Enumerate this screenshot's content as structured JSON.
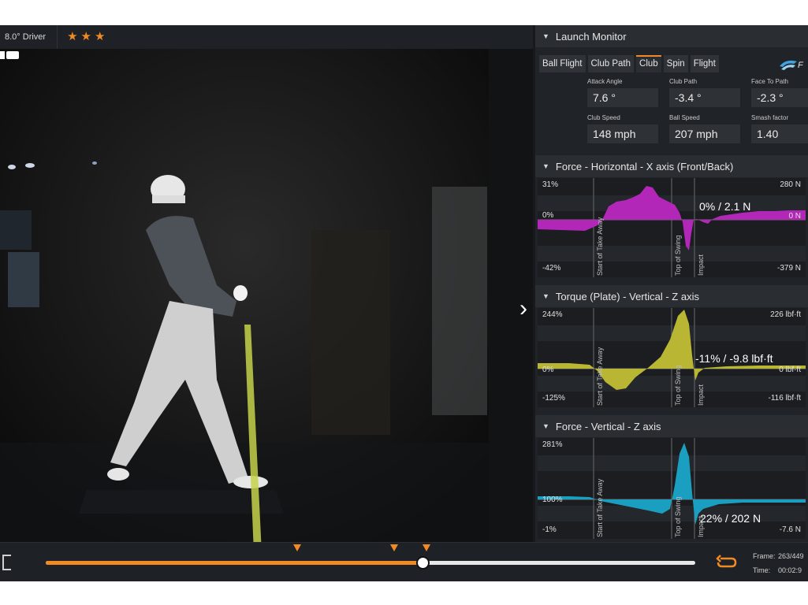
{
  "video": {
    "club_label": "8.0° Driver",
    "rating": 3
  },
  "launch_monitor": {
    "title": "Launch Monitor",
    "tabs": [
      "Ball Flight",
      "Club Path",
      "Club",
      "Spin",
      "Flight"
    ],
    "active_tab": "Club",
    "metrics": [
      {
        "label": "Attack Angle",
        "value": "7.6 °"
      },
      {
        "label": "Club Path",
        "value": "-3.4 °"
      },
      {
        "label": "Face To Path",
        "value": "-2.3 °"
      },
      {
        "label": "Club Speed",
        "value": "148 mph"
      },
      {
        "label": "Ball Speed",
        "value": "207 mph"
      },
      {
        "label": "Smash factor",
        "value": "1.40"
      }
    ]
  },
  "graphs": [
    {
      "title": "Force - Horizontal - X axis (Front/Back)",
      "color": "#b227b8",
      "top_left": "31%",
      "top_right": "280 N",
      "mid_left": "0%",
      "mid_right": "0 N",
      "bottom_left": "-42%",
      "bottom_right": "-379 N",
      "readout": "0% / 2.1 N",
      "events": [
        "Start of Take Away",
        "Top of Swing",
        "Impact"
      ]
    },
    {
      "title": "Torque (Plate) - Vertical - Z axis",
      "color": "#b8b632",
      "top_left": "244%",
      "top_right": "226 lbf·ft",
      "mid_left": "0%",
      "mid_right": "0 lbf·ft",
      "bottom_left": "-125%",
      "bottom_right": "-116 lbf·ft",
      "readout": "-11% / -9.8 lbf·ft",
      "events": [
        "Start of Take Away",
        "Top of Swing",
        "Impact"
      ]
    },
    {
      "title": "Force - Vertical - Z axis",
      "color": "#1b9fc0",
      "top_left": "281%",
      "top_right": "",
      "mid_left": "100%",
      "mid_right": "",
      "bottom_left": "-1%",
      "bottom_right": "-7.6 N",
      "readout": "22% / 202 N",
      "events": [
        "Start of Take Away",
        "Top of Swing",
        "Impact"
      ]
    }
  ],
  "timeline": {
    "progress": 0.58,
    "frame_label": "Frame:",
    "frame_value": "263/449",
    "time_label": "Time:",
    "time_value": "00:02:9"
  },
  "colors": {
    "accent": "#f08a24"
  }
}
